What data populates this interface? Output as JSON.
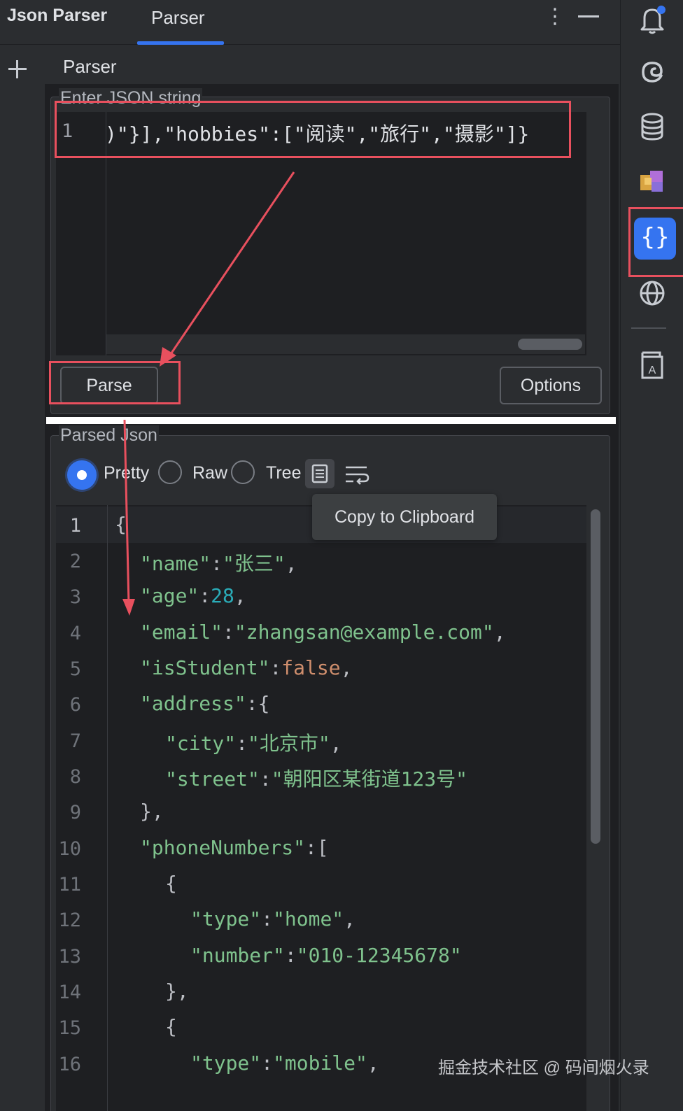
{
  "header": {
    "app_title": "Json Parser",
    "tab_label": "Parser",
    "more_icon": "more-vertical-icon",
    "minimize_icon": "minimize-icon"
  },
  "subheader": {
    "title": "Parser",
    "add_icon": "plus-icon"
  },
  "input_section": {
    "legend": "Enter JSON string",
    "line_number": "1",
    "line_text": ")\"}],\"hobbies\":[\"阅读\",\"旅行\",\"摄影\"]}",
    "parse_label": "Parse",
    "options_label": "Options"
  },
  "output_section": {
    "legend": "Parsed Json",
    "views": [
      {
        "label": "Pretty",
        "selected": true
      },
      {
        "label": "Raw",
        "selected": false
      },
      {
        "label": "Tree",
        "selected": false
      }
    ],
    "copy_icon": "copy-icon",
    "wrap_icon": "soft-wrap-icon",
    "tooltip": "Copy to Clipboard",
    "line_numbers": [
      "1",
      "2",
      "3",
      "4",
      "5",
      "6",
      "7",
      "8",
      "9",
      "10",
      "11",
      "12",
      "13",
      "14",
      "15",
      "16"
    ],
    "lines": [
      "{",
      "\"name\":\"张三\",",
      "\"age\":28,",
      "\"email\":\"zhangsan@example.com\",",
      "\"isStudent\":false,",
      "\"address\":{",
      "\"city\":\"北京市\",",
      "\"street\":\"朝阳区某街道123号\"",
      "},",
      "\"phoneNumbers\":[",
      "{",
      "\"type\":\"home\",",
      "\"number\":\"010-12345678\"",
      "},",
      "{",
      "\"type\":\"mobile\","
    ]
  },
  "sidebar": {
    "icons": [
      "notifications-icon",
      "ai-assistant-icon",
      "database-icon",
      "plugin-icon",
      "json-parser-icon",
      "web-icon",
      "translate-icon"
    ],
    "json_icon_glyph": "{}"
  },
  "watermark": "掘金技术社区 @ 码间烟火录",
  "colors": {
    "accent": "#3574f0",
    "annotation": "#e8505e",
    "background": "#1e1f22"
  }
}
